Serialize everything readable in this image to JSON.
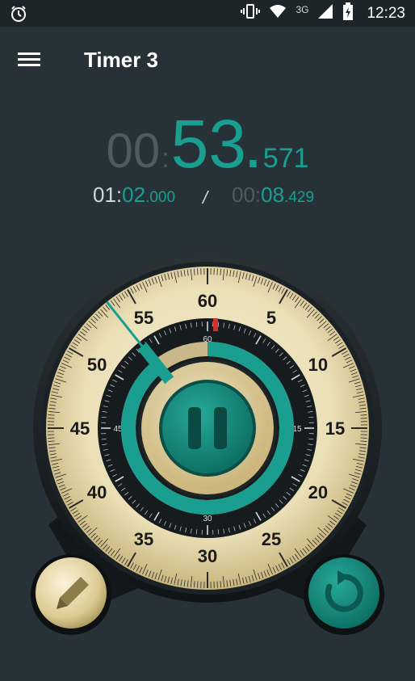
{
  "status": {
    "network": "3G",
    "time": "12:23",
    "icons": [
      "stopwatch-icon",
      "vibrate-icon",
      "wifi-icon",
      "signal-icon",
      "battery-charging-icon"
    ]
  },
  "appbar": {
    "title": "Timer 3",
    "menu_icon": "hamburger-menu-icon"
  },
  "main_time": {
    "minutes": "00",
    "colon": ":",
    "seconds": "53",
    "dot": ".",
    "millis": "571"
  },
  "lap_left": {
    "minutes": "01",
    "colon": ":",
    "seconds": "02",
    "dot": ".",
    "millis": "000"
  },
  "separator": "/",
  "lap_right": {
    "minutes": "00",
    "colon": ":",
    "seconds": "08",
    "dot": ".",
    "millis": "429"
  },
  "dial": {
    "outer_labels": [
      "60",
      "5",
      "10",
      "15",
      "20",
      "25",
      "30",
      "35",
      "40",
      "45",
      "50",
      "55"
    ],
    "inner_labels": [
      "60",
      "15",
      "30",
      "45"
    ],
    "progress_fraction": 0.883,
    "hand_seconds": 53.571
  },
  "buttons": {
    "pause_icon": "pause-icon",
    "edit_icon": "pencil-icon",
    "reset_icon": "reset-icon"
  },
  "colors": {
    "teal": "#1a9e8f",
    "background": "#263238",
    "dial_face": "#efe6c4",
    "red_marker": "#d32f2f"
  }
}
